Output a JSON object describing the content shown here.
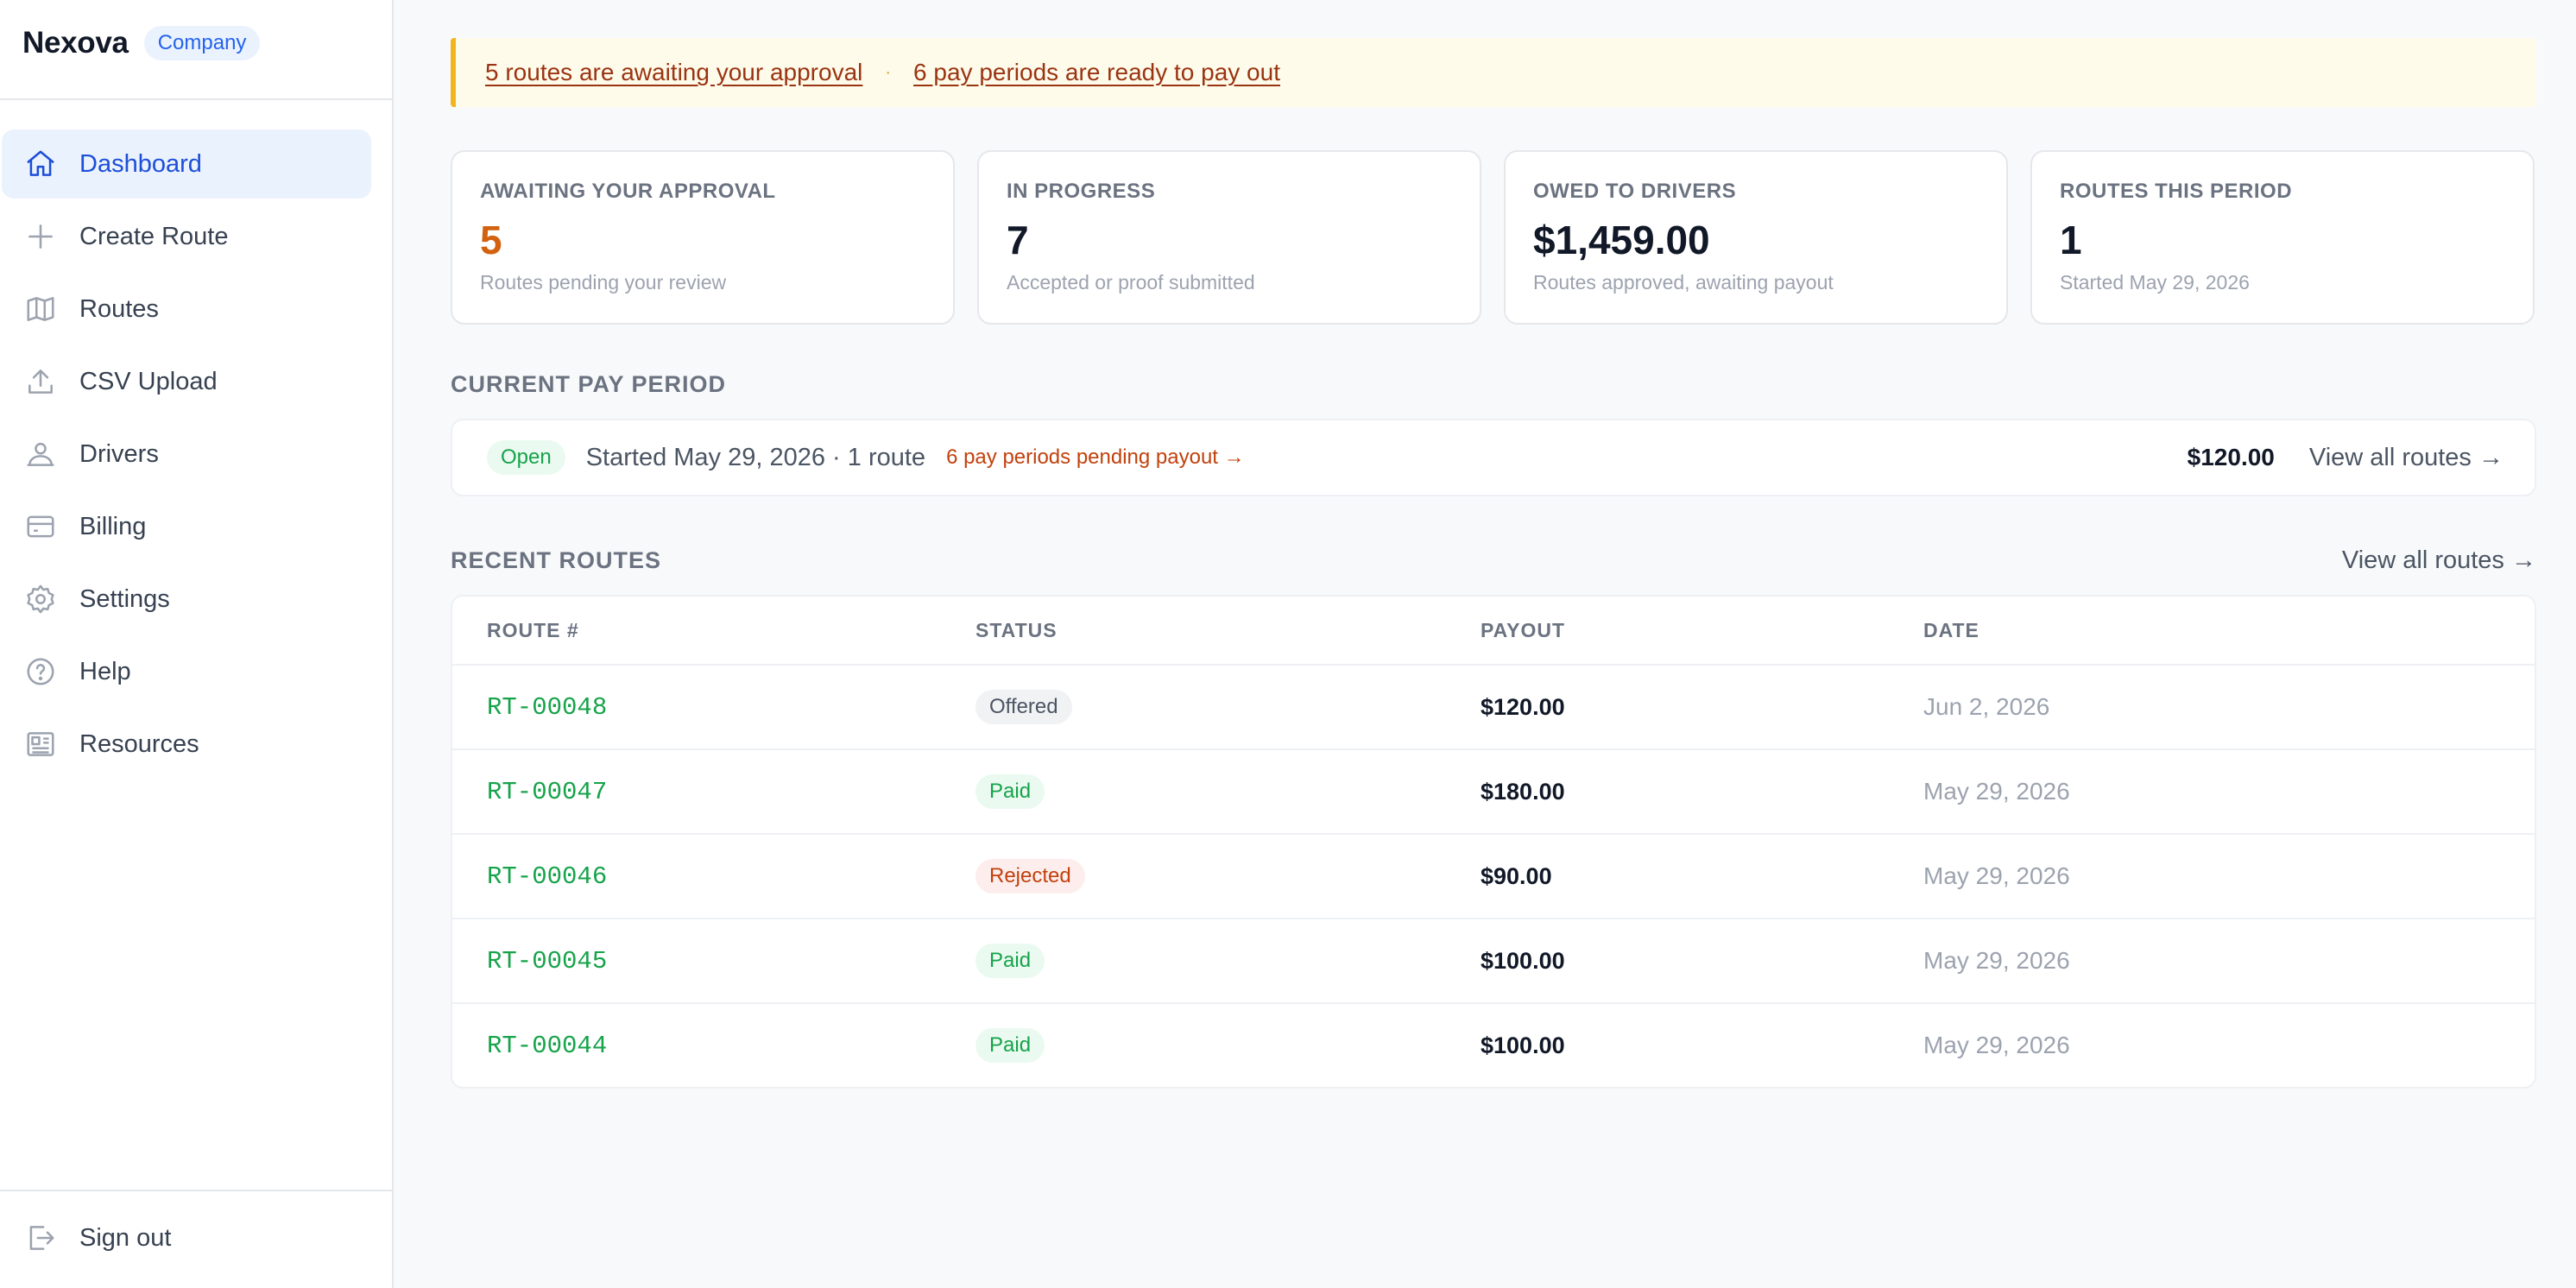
{
  "brand": {
    "name": "Nexova",
    "badge": "Company"
  },
  "nav": [
    {
      "label": "Dashboard",
      "icon": "home-icon",
      "active": true
    },
    {
      "label": "Create Route",
      "icon": "plus-icon"
    },
    {
      "label": "Routes",
      "icon": "map-icon"
    },
    {
      "label": "CSV Upload",
      "icon": "upload-icon"
    },
    {
      "label": "Drivers",
      "icon": "drivers-icon"
    },
    {
      "label": "Billing",
      "icon": "credit-card-icon"
    },
    {
      "label": "Settings",
      "icon": "gear-icon"
    },
    {
      "label": "Help",
      "icon": "help-icon"
    },
    {
      "label": "Resources",
      "icon": "newspaper-icon"
    }
  ],
  "signout": {
    "label": "Sign out",
    "icon": "sign-out-icon"
  },
  "alert": {
    "approval_link": "5 routes are awaiting your approval",
    "separator": "·",
    "payout_link": "6 pay periods are ready to pay out",
    "accent_color": "#f2b51d"
  },
  "stats": [
    {
      "label": "AWAITING YOUR APPROVAL",
      "value": "5",
      "sub": "Routes pending your review",
      "color": "#d2620f"
    },
    {
      "label": "IN PROGRESS",
      "value": "7",
      "sub": "Accepted or proof submitted"
    },
    {
      "label": "OWED TO DRIVERS",
      "value": "$1,459.00",
      "sub": "Routes approved, awaiting payout"
    },
    {
      "label": "ROUTES THIS PERIOD",
      "value": "1",
      "sub": "Started May 29, 2026"
    }
  ],
  "pay_period": {
    "title": "CURRENT PAY PERIOD",
    "status": "Open",
    "summary": "Started May 29, 2026 · 1 route",
    "pending": "6 pay periods pending payout →",
    "amount": "$120.00",
    "link": "View all routes →"
  },
  "recent": {
    "title": "RECENT ROUTES",
    "link": "View all routes →",
    "columns": [
      "ROUTE #",
      "STATUS",
      "PAYOUT",
      "DATE"
    ],
    "rows": [
      {
        "route": "RT-00048",
        "status": "Offered",
        "status_kind": "offered",
        "payout": "$120.00",
        "date": "Jun 2, 2026"
      },
      {
        "route": "RT-00047",
        "status": "Paid",
        "status_kind": "paid",
        "payout": "$180.00",
        "date": "May 29, 2026"
      },
      {
        "route": "RT-00046",
        "status": "Rejected",
        "status_kind": "rejected",
        "payout": "$90.00",
        "date": "May 29, 2026"
      },
      {
        "route": "RT-00045",
        "status": "Paid",
        "status_kind": "paid",
        "payout": "$100.00",
        "date": "May 29, 2026"
      },
      {
        "route": "RT-00044",
        "status": "Paid",
        "status_kind": "paid",
        "payout": "$100.00",
        "date": "May 29, 2026"
      }
    ]
  },
  "colors": {
    "accent": "#1d4ed8",
    "route_green": "#16a34a",
    "warning": "#c2410c"
  }
}
